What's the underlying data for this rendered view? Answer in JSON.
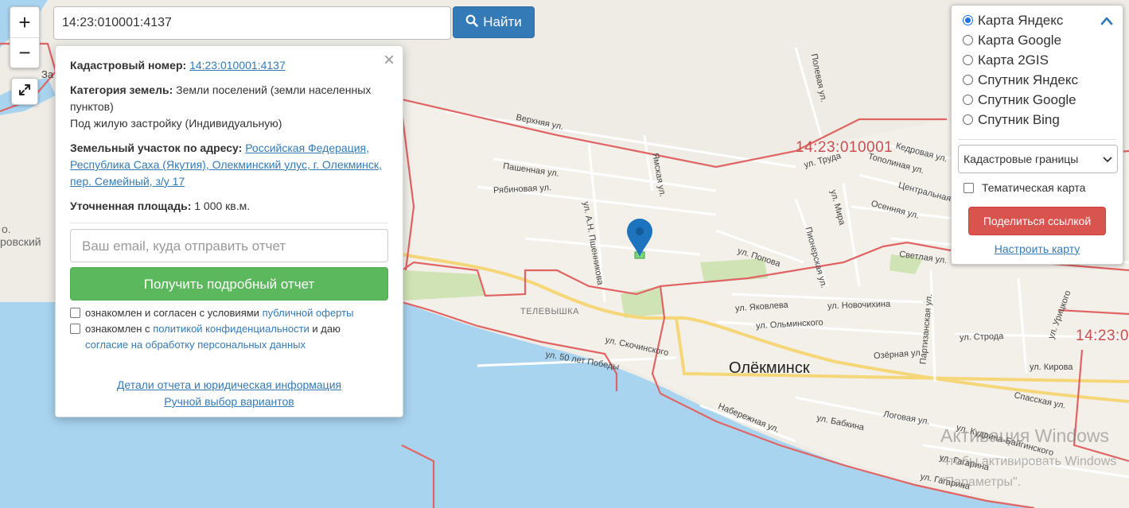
{
  "search": {
    "value": "14:23:010001:4137",
    "button_label": "Найти"
  },
  "zoom": {
    "in_label": "+",
    "out_label": "−"
  },
  "popup": {
    "close_label": "×",
    "cadastral_label": "Кадастровый номер:",
    "cadastral_value": "14:23:010001:4137",
    "category_label": "Категория земель:",
    "category_value": "Земли поселений (земли населенных пунктов)",
    "usage_value": "Под жилую застройку (Индивидуальную)",
    "address_label": "Земельный участок по адресу:",
    "address_value": "Российская Федерация, Республика Саха (Якутия), Олекминский улус, г. Олекминск, пер. Семейный, з/у 17",
    "area_label": "Уточненная площадь:",
    "area_value": "1 000 кв.м.",
    "email_placeholder": "Ваш email, куда отправить отчет",
    "report_button": "Получить подробный отчет",
    "agree1_text": "ознакомлен и согласен с условиями",
    "agree1_link": "публичной оферты",
    "agree2_text": "ознакомлен с",
    "agree2_link1": "политикой конфиденциальности",
    "agree2_mid": "и даю",
    "agree2_link2": "согласие на обработку персональных данных",
    "details_link": "Детали отчета и юридическая информация",
    "manual_link": "Ручной выбор вариантов"
  },
  "layers": {
    "options": [
      {
        "label": "Карта Яндекс",
        "selected": true
      },
      {
        "label": "Карта Google",
        "selected": false
      },
      {
        "label": "Карта 2GIS",
        "selected": false
      },
      {
        "label": "Спутник Яндекс",
        "selected": false
      },
      {
        "label": "Спутник Google",
        "selected": false
      },
      {
        "label": "Спутник Bing",
        "selected": false
      }
    ],
    "select_value": "Кадастровые границы",
    "thematic_label": "Тематическая карта",
    "share_button": "Поделиться ссылкой",
    "setup_link": "Настроить карту"
  },
  "map": {
    "city": "Олёкминск",
    "cad_label_1": "14:23:010001",
    "cad_label_2": "14:23:0",
    "district": "ТЕЛЕВЫШКА",
    "left_frag_1": "За",
    "left_frag_2": "о.",
    "left_frag_3": "ровский",
    "streets": {
      "verkhnyaya": "Верхняя ул.",
      "pashennaya": "Пашенная ул.",
      "ryabinovaya": "Рябиновая ул.",
      "yamskaya": "Ямская ул.",
      "pshennikova": "ул. А.Н. Пшенникова",
      "polevaya": "Полевая ул.",
      "truda": "ул. Труда",
      "kedrovaya": "Кедровая ул.",
      "topolinaya": "Тополиная ул.",
      "tsentralnaya": "Центральная ул.",
      "osennyaya": "Осенняя ул.",
      "mira": "ул. Мира",
      "pionerskaya": "Пионерская ул.",
      "popova": "ул. Попова",
      "svetlaya": "Светлая ул.",
      "yakovleva": "ул. Яковлева",
      "novochikhina": "ул. Новочихина",
      "olminskogo": "ул. Ольминского",
      "skochinskogo": "ул. Скочинского",
      "pobedy": "ул. 50 лет Победы",
      "partizanskaya": "Партизанская ул.",
      "uritskogo": "ул. Урицкого",
      "stroda": "ул. Строда",
      "ozernaya": "Озёрная ул.",
      "kirova": "ул. Кирова",
      "spasskaya": "Спасская ул.",
      "naberezhnaya": "Набережная ул.",
      "babkina": "ул. Бабкина",
      "logovaya": "Логовая ул.",
      "kudrina": "ул. Кудрина-Байгинского",
      "gagarina1": "ул. Гагарина",
      "gagarina2": "ул. Гагарина"
    }
  },
  "watermark": {
    "line1": "Активация Windows",
    "line2": "Чтобы активировать Windows",
    "line3": "\"Параметры\"."
  },
  "colors": {
    "water": "#a9d4f0",
    "land": "#efece6",
    "cadastral_border": "#e06464",
    "primary": "#337ab7",
    "success": "#5cb85c",
    "danger": "#d9534f",
    "marker": "#1e73be"
  }
}
